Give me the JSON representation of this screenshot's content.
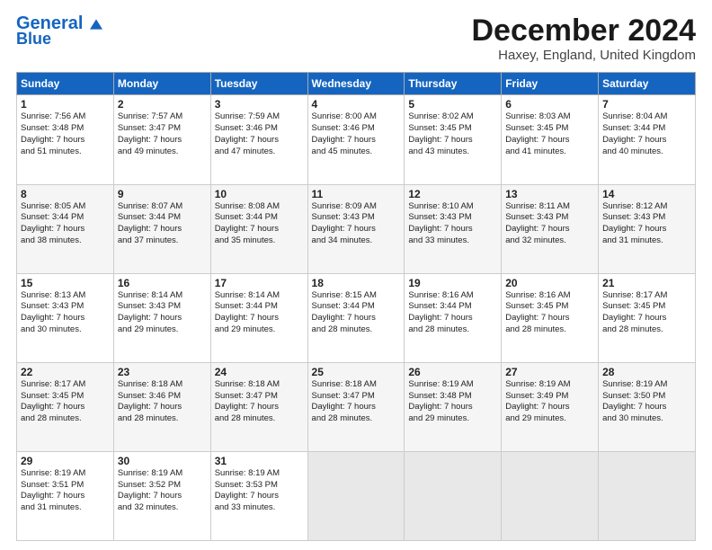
{
  "header": {
    "logo_line1": "General",
    "logo_line2": "Blue",
    "month": "December 2024",
    "location": "Haxey, England, United Kingdom"
  },
  "days_of_week": [
    "Sunday",
    "Monday",
    "Tuesday",
    "Wednesday",
    "Thursday",
    "Friday",
    "Saturday"
  ],
  "weeks": [
    [
      {
        "day": "1",
        "text": "Sunrise: 7:56 AM\nSunset: 3:48 PM\nDaylight: 7 hours\nand 51 minutes."
      },
      {
        "day": "2",
        "text": "Sunrise: 7:57 AM\nSunset: 3:47 PM\nDaylight: 7 hours\nand 49 minutes."
      },
      {
        "day": "3",
        "text": "Sunrise: 7:59 AM\nSunset: 3:46 PM\nDaylight: 7 hours\nand 47 minutes."
      },
      {
        "day": "4",
        "text": "Sunrise: 8:00 AM\nSunset: 3:46 PM\nDaylight: 7 hours\nand 45 minutes."
      },
      {
        "day": "5",
        "text": "Sunrise: 8:02 AM\nSunset: 3:45 PM\nDaylight: 7 hours\nand 43 minutes."
      },
      {
        "day": "6",
        "text": "Sunrise: 8:03 AM\nSunset: 3:45 PM\nDaylight: 7 hours\nand 41 minutes."
      },
      {
        "day": "7",
        "text": "Sunrise: 8:04 AM\nSunset: 3:44 PM\nDaylight: 7 hours\nand 40 minutes."
      }
    ],
    [
      {
        "day": "8",
        "text": "Sunrise: 8:05 AM\nSunset: 3:44 PM\nDaylight: 7 hours\nand 38 minutes."
      },
      {
        "day": "9",
        "text": "Sunrise: 8:07 AM\nSunset: 3:44 PM\nDaylight: 7 hours\nand 37 minutes."
      },
      {
        "day": "10",
        "text": "Sunrise: 8:08 AM\nSunset: 3:44 PM\nDaylight: 7 hours\nand 35 minutes."
      },
      {
        "day": "11",
        "text": "Sunrise: 8:09 AM\nSunset: 3:43 PM\nDaylight: 7 hours\nand 34 minutes."
      },
      {
        "day": "12",
        "text": "Sunrise: 8:10 AM\nSunset: 3:43 PM\nDaylight: 7 hours\nand 33 minutes."
      },
      {
        "day": "13",
        "text": "Sunrise: 8:11 AM\nSunset: 3:43 PM\nDaylight: 7 hours\nand 32 minutes."
      },
      {
        "day": "14",
        "text": "Sunrise: 8:12 AM\nSunset: 3:43 PM\nDaylight: 7 hours\nand 31 minutes."
      }
    ],
    [
      {
        "day": "15",
        "text": "Sunrise: 8:13 AM\nSunset: 3:43 PM\nDaylight: 7 hours\nand 30 minutes."
      },
      {
        "day": "16",
        "text": "Sunrise: 8:14 AM\nSunset: 3:43 PM\nDaylight: 7 hours\nand 29 minutes."
      },
      {
        "day": "17",
        "text": "Sunrise: 8:14 AM\nSunset: 3:44 PM\nDaylight: 7 hours\nand 29 minutes."
      },
      {
        "day": "18",
        "text": "Sunrise: 8:15 AM\nSunset: 3:44 PM\nDaylight: 7 hours\nand 28 minutes."
      },
      {
        "day": "19",
        "text": "Sunrise: 8:16 AM\nSunset: 3:44 PM\nDaylight: 7 hours\nand 28 minutes."
      },
      {
        "day": "20",
        "text": "Sunrise: 8:16 AM\nSunset: 3:45 PM\nDaylight: 7 hours\nand 28 minutes."
      },
      {
        "day": "21",
        "text": "Sunrise: 8:17 AM\nSunset: 3:45 PM\nDaylight: 7 hours\nand 28 minutes."
      }
    ],
    [
      {
        "day": "22",
        "text": "Sunrise: 8:17 AM\nSunset: 3:45 PM\nDaylight: 7 hours\nand 28 minutes."
      },
      {
        "day": "23",
        "text": "Sunrise: 8:18 AM\nSunset: 3:46 PM\nDaylight: 7 hours\nand 28 minutes."
      },
      {
        "day": "24",
        "text": "Sunrise: 8:18 AM\nSunset: 3:47 PM\nDaylight: 7 hours\nand 28 minutes."
      },
      {
        "day": "25",
        "text": "Sunrise: 8:18 AM\nSunset: 3:47 PM\nDaylight: 7 hours\nand 28 minutes."
      },
      {
        "day": "26",
        "text": "Sunrise: 8:19 AM\nSunset: 3:48 PM\nDaylight: 7 hours\nand 29 minutes."
      },
      {
        "day": "27",
        "text": "Sunrise: 8:19 AM\nSunset: 3:49 PM\nDaylight: 7 hours\nand 29 minutes."
      },
      {
        "day": "28",
        "text": "Sunrise: 8:19 AM\nSunset: 3:50 PM\nDaylight: 7 hours\nand 30 minutes."
      }
    ],
    [
      {
        "day": "29",
        "text": "Sunrise: 8:19 AM\nSunset: 3:51 PM\nDaylight: 7 hours\nand 31 minutes."
      },
      {
        "day": "30",
        "text": "Sunrise: 8:19 AM\nSunset: 3:52 PM\nDaylight: 7 hours\nand 32 minutes."
      },
      {
        "day": "31",
        "text": "Sunrise: 8:19 AM\nSunset: 3:53 PM\nDaylight: 7 hours\nand 33 minutes."
      },
      {
        "day": "",
        "text": ""
      },
      {
        "day": "",
        "text": ""
      },
      {
        "day": "",
        "text": ""
      },
      {
        "day": "",
        "text": ""
      }
    ]
  ]
}
